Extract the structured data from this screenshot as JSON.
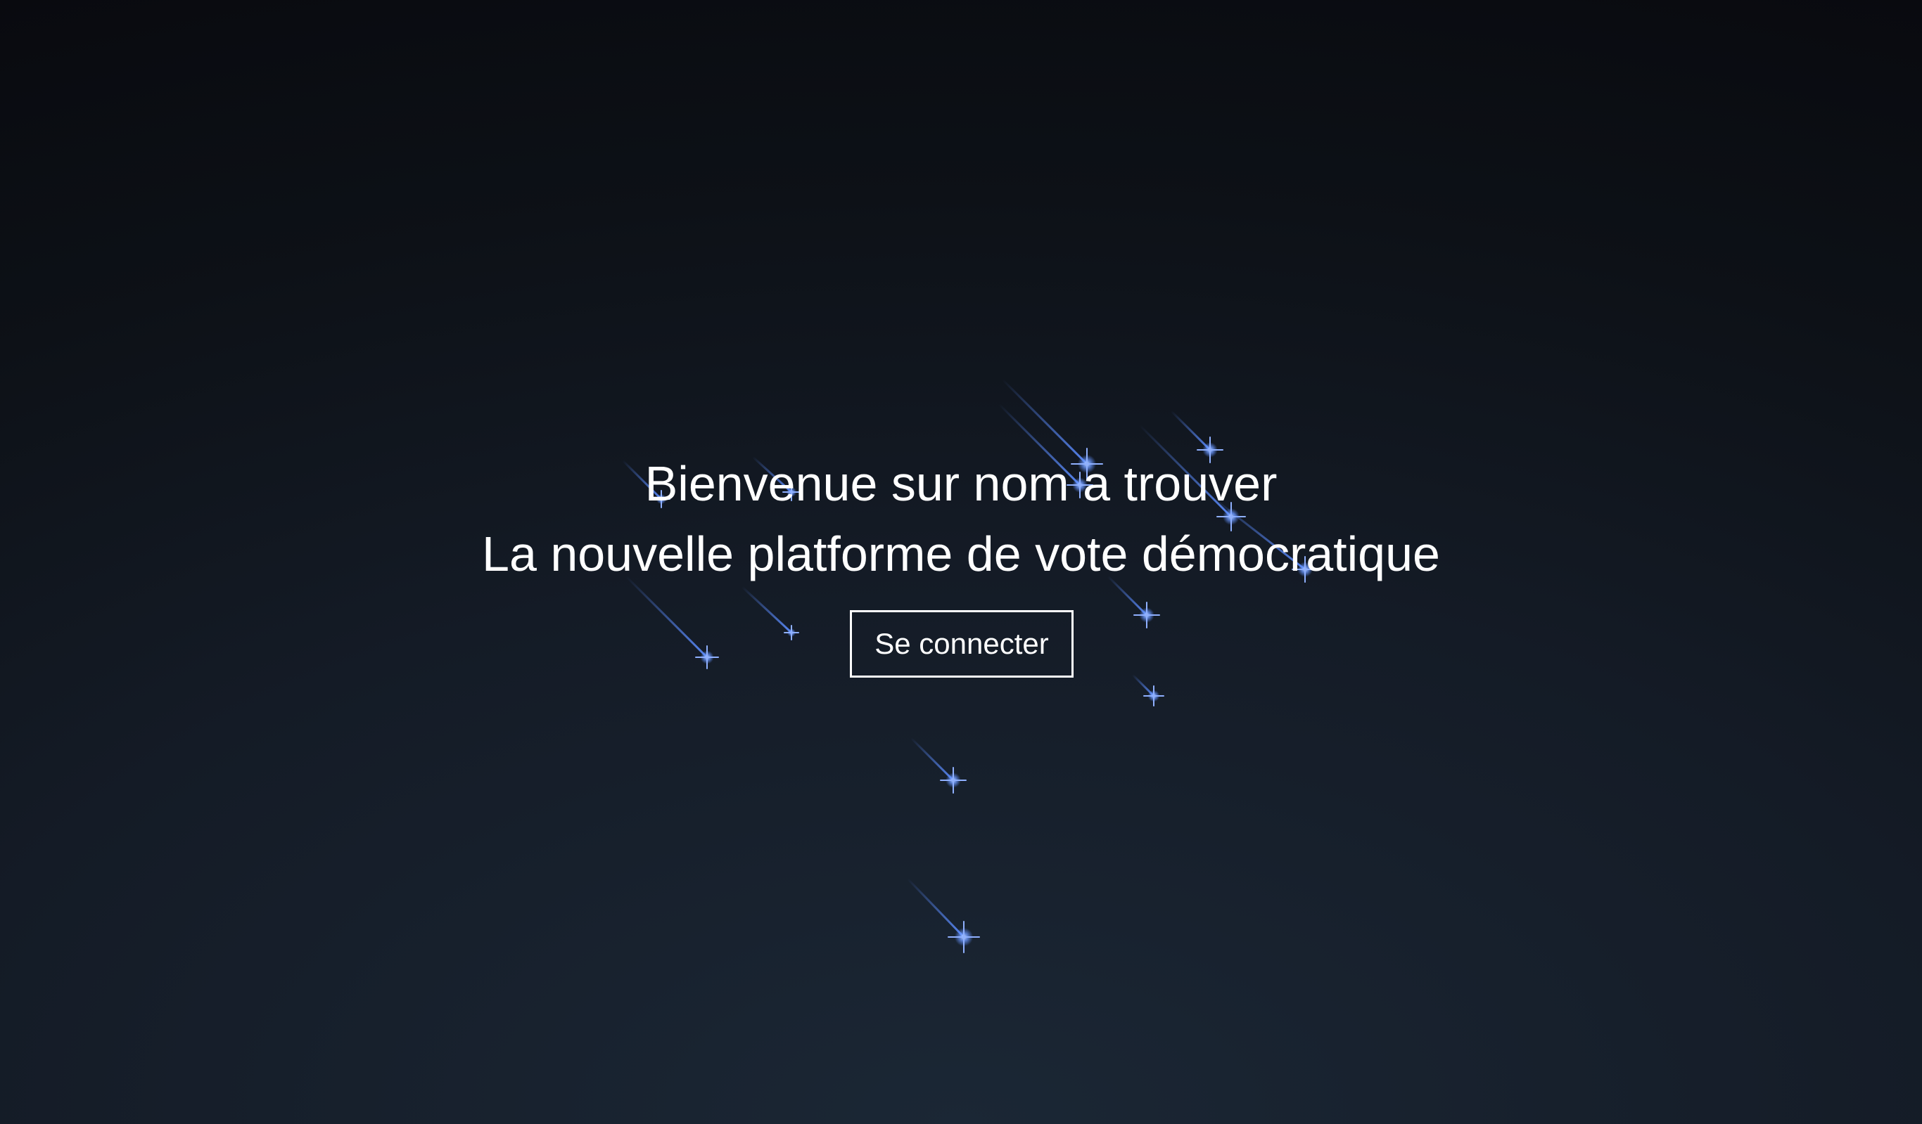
{
  "hero": {
    "welcome_line": "Bienvenue sur nom a trouver",
    "tagline_line": "La nouvelle platforme de vote démocratique",
    "login_button_label": "Se connecter"
  },
  "theme": {
    "background_center": "#1b2735",
    "background_edge": "#090a0f",
    "star_color": "#5b8cff",
    "text_color": "#ffffff"
  }
}
